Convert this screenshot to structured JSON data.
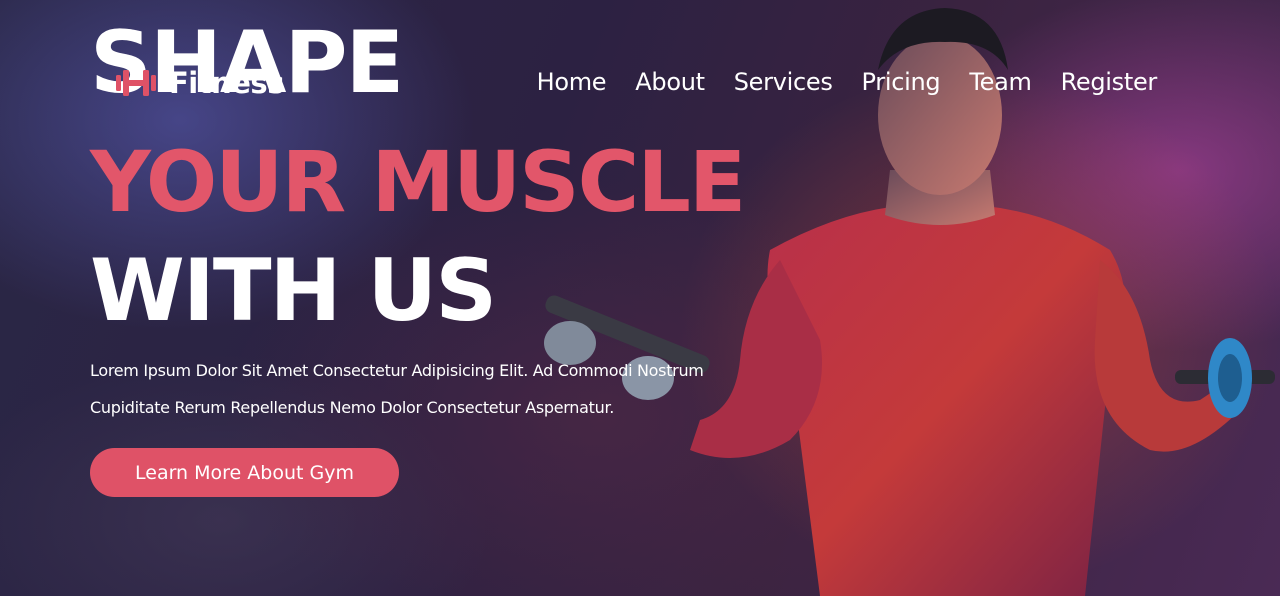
{
  "brand": {
    "name": "Fitness",
    "icon": "dumbbell-icon",
    "accent_color": "#df5267"
  },
  "nav": {
    "items": [
      {
        "label": "Home"
      },
      {
        "label": "About"
      },
      {
        "label": "Services"
      },
      {
        "label": "Pricing"
      },
      {
        "label": "Team"
      },
      {
        "label": "Register"
      }
    ]
  },
  "hero": {
    "headline_line1": "SHAPE",
    "headline_line2": "YOUR MUSCLE",
    "headline_line3": "WITH US",
    "description_line1": "Lorem Ipsum Dolor Sit Amet Consectetur Adipisicing Elit. Ad Commodi Nostrum",
    "description_line2": "Cupiditate Rerum Repellendus Nemo Dolor Consectetur Aspernatur.",
    "cta_label": "Learn More About Gym"
  }
}
